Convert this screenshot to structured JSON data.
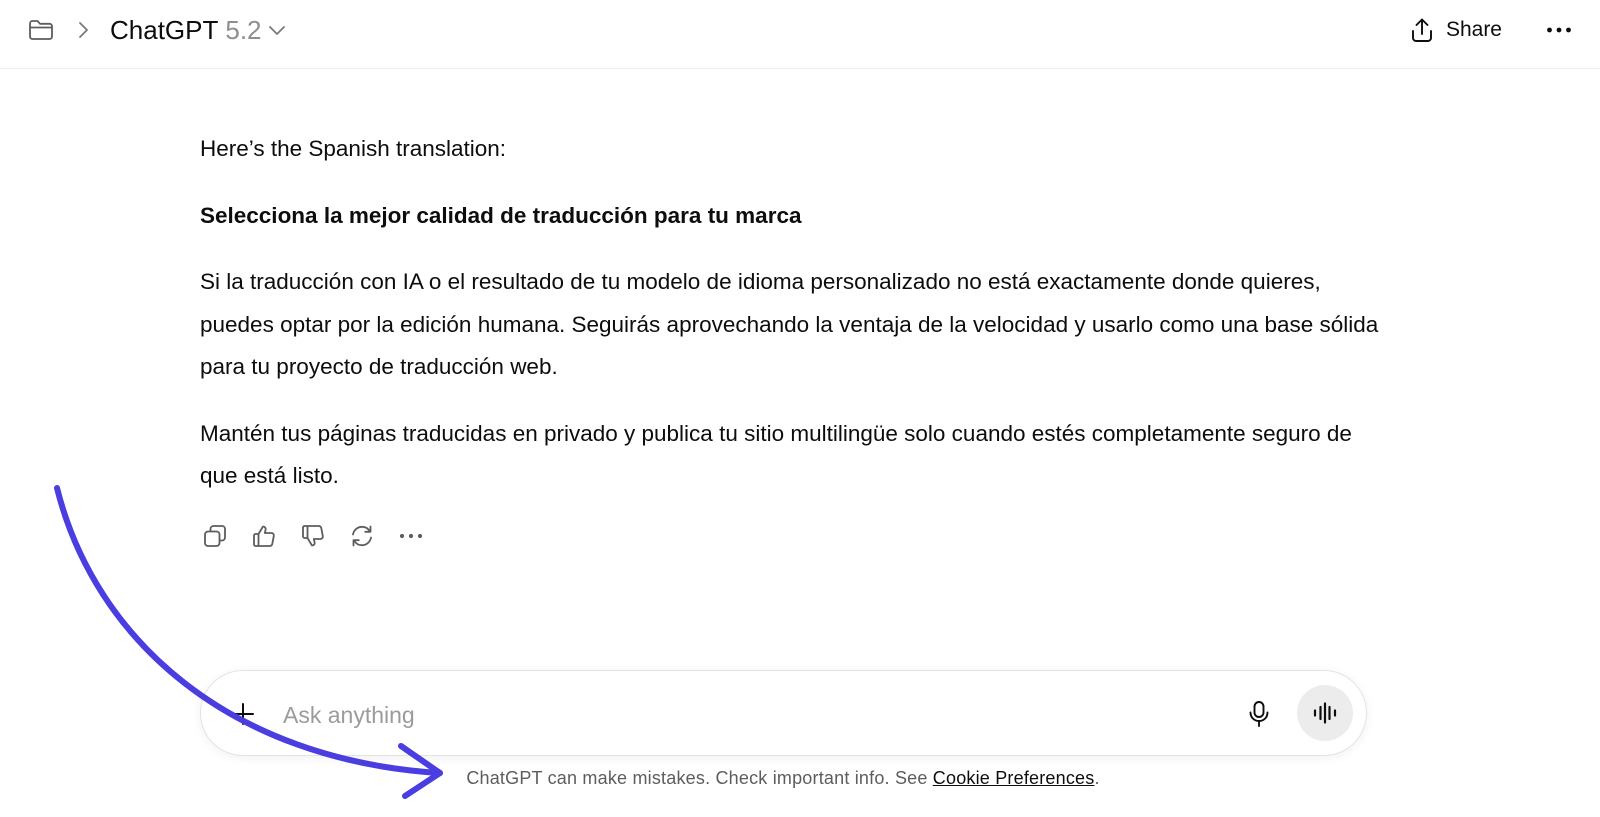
{
  "header": {
    "model_name": "ChatGPT",
    "model_version": "5.2",
    "share_label": "Share",
    "icons": {
      "folder": "folder-icon",
      "breadcrumb": "chevron-right-icon",
      "model_dropdown": "chevron-down-icon",
      "share": "share-upload-icon",
      "more": "more-horizontal-icon"
    }
  },
  "message": {
    "intro": "Here’s the Spanish translation:",
    "heading": "Selecciona la mejor calidad de traducción para tu marca",
    "paragraphs": [
      "Si la traducción con IA o el resultado de tu modelo de idioma personalizado no está exactamente donde quieres, puedes optar por la edición humana. Seguirás aprovechando la ventaja de la velocidad y usarlo como una base sólida para tu proyecto de traducción web.",
      "Mantén tus páginas traducidas en privado y publica tu sitio multilingüe solo cuando estés completamente seguro de que está listo."
    ],
    "actions": [
      "copy-icon",
      "thumbs-up-icon",
      "thumbs-down-icon",
      "regenerate-icon",
      "more-horizontal-icon"
    ]
  },
  "composer": {
    "placeholder": "Ask anything",
    "value": "",
    "icons": {
      "attach": "plus-icon",
      "dictate": "microphone-icon",
      "voice": "voice-waveform-icon"
    }
  },
  "footer": {
    "disclaimer_prefix": "ChatGPT can make mistakes. Check important info. See ",
    "link_label": "Cookie Preferences",
    "disclaimer_suffix": "."
  },
  "colors": {
    "text": "#0d0d0d",
    "muted": "#8f8f8f",
    "placeholder": "#9b9b9b",
    "border": "#e3e3e3",
    "voice_button_bg": "#ececec",
    "annotation_arrow": "#4a3ee0"
  }
}
